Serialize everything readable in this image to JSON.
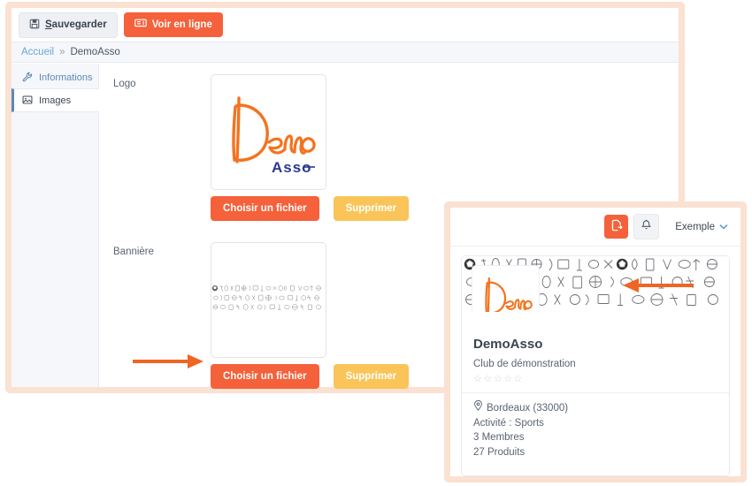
{
  "editor": {
    "toolbar": {
      "save_label_prefix": "S",
      "save_label_rest": "auvegarder",
      "save_icon": "save-disk-icon",
      "view_online_label": "Voir en ligne",
      "view_online_icon": "monitor-icon"
    },
    "breadcrumb": {
      "home": "Accueil",
      "separator": "»",
      "current": "DemoAsso"
    },
    "tabs": [
      {
        "label": "Informations",
        "icon": "wrench-icon",
        "active": false
      },
      {
        "label": "Images",
        "icon": "image-icon",
        "active": true
      }
    ],
    "fields": [
      {
        "label": "Logo",
        "choose_label": "Choisir un fichier",
        "delete_label": "Supprimer"
      },
      {
        "label": "Bannière",
        "choose_label": "Choisir un fichier",
        "delete_label": "Supprimer"
      }
    ]
  },
  "preview": {
    "header": {
      "primary_icon": "file-export-icon",
      "bell_icon": "bell-icon",
      "user_label": "Exemple",
      "user_chevron_icon": "chevron-down-icon"
    },
    "card": {
      "title": "DemoAsso",
      "subtitle": "Club de démonstration",
      "rating_stars": "☆☆☆☆☆",
      "location_icon": "map-pin-icon",
      "location": "Bordeaux (33000)",
      "activity": "Activité : Sports",
      "members": "3 Membres",
      "products": "27 Produits"
    }
  },
  "logo": {
    "word_main": "Demo",
    "word_sub": "Asso"
  },
  "colors": {
    "accent_orange": "#f4613a",
    "accent_yellow": "#fac459",
    "frame_peach": "#fae1d2",
    "link_blue": "#68a6dd",
    "logo_navy": "#2b3a8f",
    "text_dark": "#3a4450"
  },
  "annotations": {
    "arrow_banner_button": "arrow-pointing-right-to-choose-file",
    "arrow_card_banner": "arrow-pointing-left-to-card-banner"
  }
}
